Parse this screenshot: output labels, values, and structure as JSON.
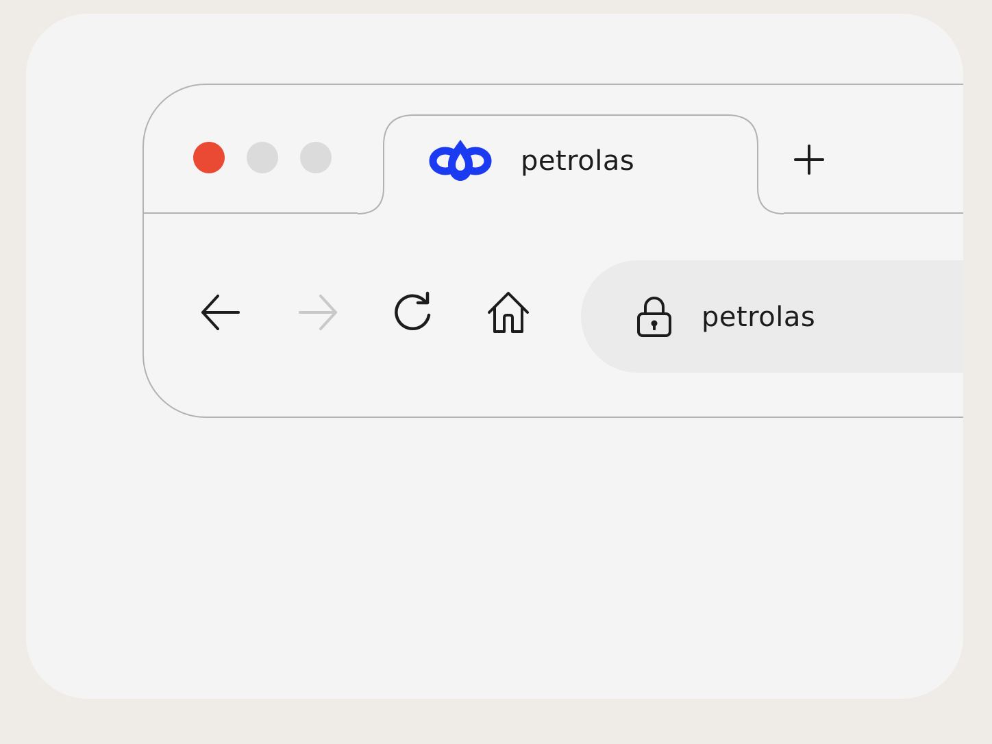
{
  "window": {
    "controls": [
      "close",
      "minimize",
      "maximize"
    ],
    "close_color": "#ea4a33",
    "inactive_color": "#dbdbdb"
  },
  "tab": {
    "title": "petrolas",
    "icon": "petrolas-logo-icon",
    "icon_color": "#1a3bf2"
  },
  "new_tab": {
    "icon": "plus-icon"
  },
  "toolbar": {
    "back_icon": "arrow-left-icon",
    "forward_icon": "arrow-right-icon",
    "forward_enabled": false,
    "reload_icon": "reload-icon",
    "home_icon": "home-icon"
  },
  "address_bar": {
    "icon": "lock-icon",
    "text": "petrolas"
  }
}
